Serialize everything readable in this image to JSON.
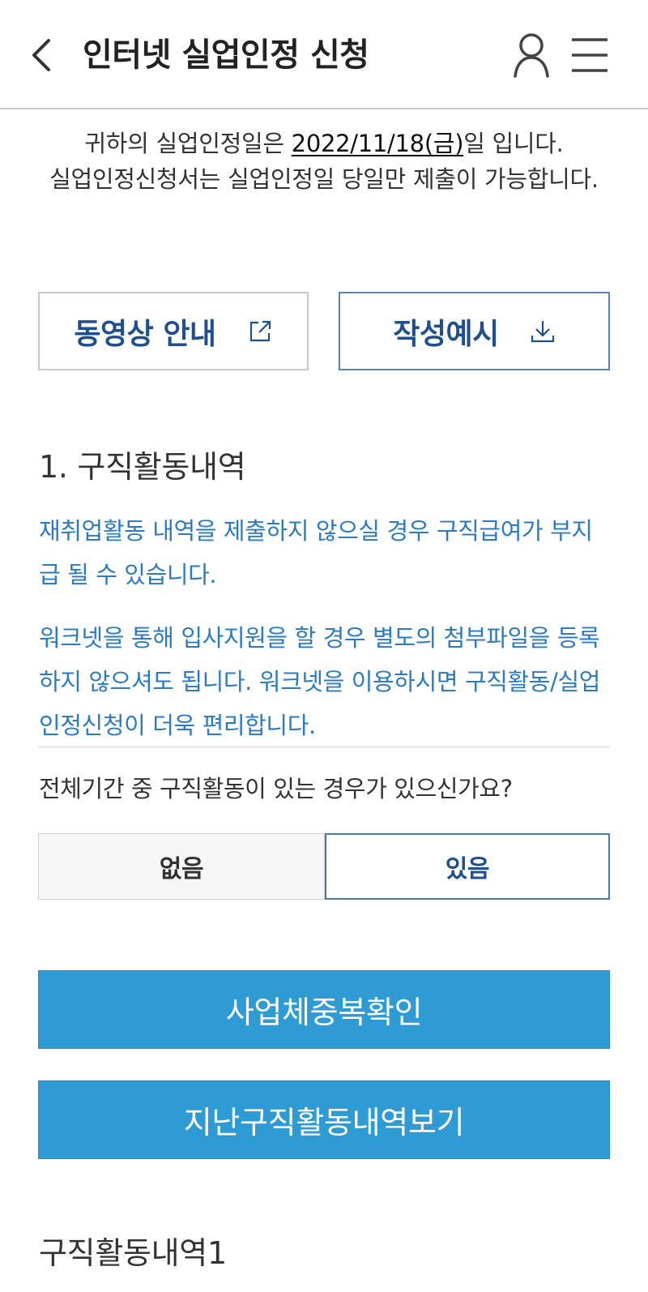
{
  "header": {
    "title": "인터넷 실업인정 신청"
  },
  "notice": {
    "prefix": "귀하의 실업인정일은 ",
    "date": "2022/11/18(금)",
    "suffix": "일 입니다.",
    "line2": "실업인정신청서는 실업인정일 당일만 제출이 가능합니다."
  },
  "buttons": {
    "video_guide": "동영상 안내",
    "example": "작성예시",
    "business_duplicate_check": "사업체중복확인",
    "past_activity_view": "지난구직활동내역보기"
  },
  "section": {
    "title": "1. 구직활동내역",
    "info1": "재취업활동 내역을 제출하지 않으실 경우 구직급여가 부지급 될 수 있습니다.",
    "info2": "워크넷을 통해 입사지원을 할 경우 별도의 첨부파일을 등록하지 않으셔도 됩니다. 워크넷을 이용하시면 구직활동/실업인정신청이 더욱 편리합니다.",
    "question": "전체기간 중 구직활동이 있는 경우가 있으신가요?",
    "options": [
      "없음",
      "있음"
    ],
    "selected": "있음"
  },
  "activity": {
    "title": "구직활동내역1"
  },
  "colors": {
    "primary": "#2f9bd4",
    "accent_text": "#1f4f8f",
    "info_text": "#2b7bc4"
  },
  "icons": [
    "back-arrow-icon",
    "user-icon",
    "menu-icon",
    "external-link-icon",
    "download-icon"
  ]
}
